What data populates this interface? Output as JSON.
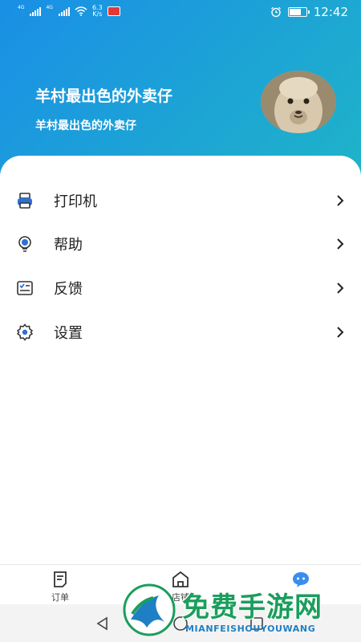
{
  "status_bar": {
    "net1": "4G",
    "net2": "4G",
    "speed_value": "6.3",
    "speed_unit": "K/s",
    "time": "12:42"
  },
  "profile": {
    "name": "羊村最出色的外卖仔",
    "subtitle": "羊村最出色的外卖仔"
  },
  "menu": [
    {
      "label": "打印机",
      "icon": "printer-icon"
    },
    {
      "label": "帮助",
      "icon": "lightbulb-icon"
    },
    {
      "label": "反馈",
      "icon": "feedback-icon"
    },
    {
      "label": "设置",
      "icon": "gear-icon"
    }
  ],
  "tabs": [
    {
      "label": "订单",
      "icon": "order-icon"
    },
    {
      "label": "店铺",
      "icon": "store-icon"
    },
    {
      "label": "",
      "icon": "profile-chat-icon"
    }
  ],
  "watermark": {
    "title": "免费手游网",
    "subtitle": "MIANFEISHOUYOUWANG"
  },
  "colors": {
    "header_gradient_start": "#1a8fe6",
    "header_gradient_end": "#1fb4c8",
    "icon_blue": "#2f6fd8",
    "watermark_green": "#1a9e5c"
  }
}
